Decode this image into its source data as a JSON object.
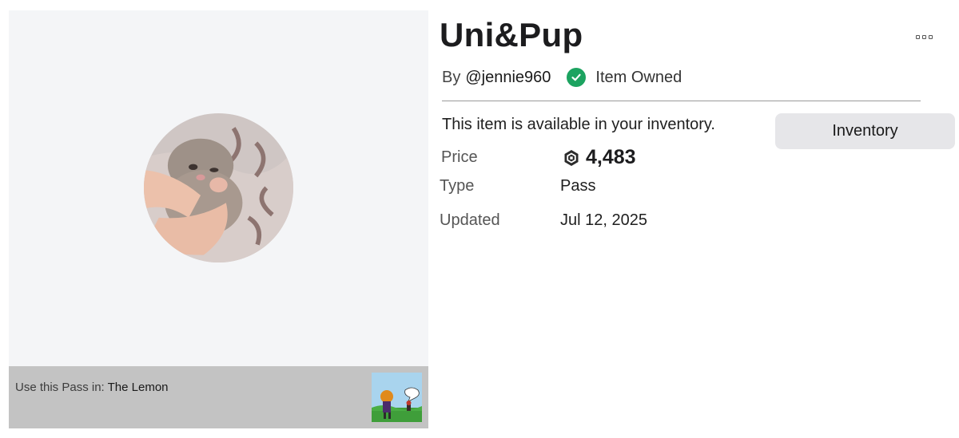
{
  "item": {
    "title": "Uni&Pup",
    "by_label": "By",
    "creator": "@jennie960",
    "owned_label": "Item Owned",
    "availability": "This item is available in your inventory.",
    "inventory_button": "Inventory"
  },
  "details": {
    "price_label": "Price",
    "price_value": "4,483",
    "type_label": "Type",
    "type_value": "Pass",
    "updated_label": "Updated",
    "updated_value": "Jul 12, 2025"
  },
  "usage": {
    "prefix": "Use this Pass in:",
    "game_name": "The Lemon"
  },
  "icons": {
    "owned": "check-circle-icon",
    "currency": "robux-icon",
    "menu": "more-options-icon"
  },
  "colors": {
    "owned_green": "#1ca360",
    "panel_bg": "#f4f5f7",
    "usage_bar_bg": "#c3c3c3",
    "button_bg": "#e6e6e9"
  }
}
